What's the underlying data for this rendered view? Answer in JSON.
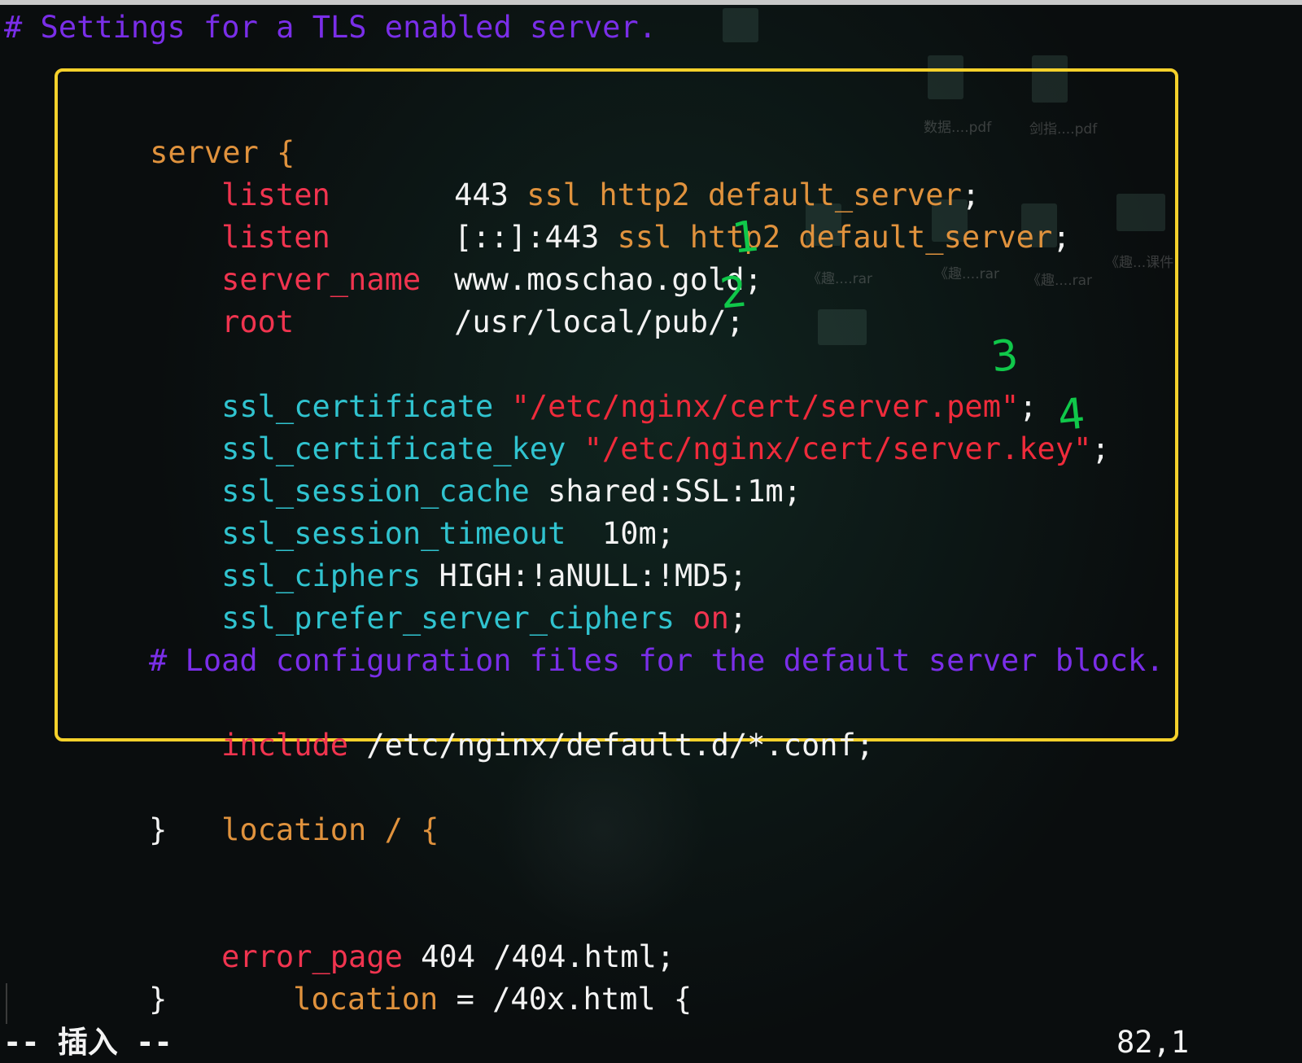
{
  "header_comment": "# Settings for a TLS enabled server.",
  "server_block": {
    "open": "server {",
    "listen1": {
      "directive": "listen",
      "port": "443",
      "args": "ssl http2 default_server",
      "end": ";"
    },
    "listen2": {
      "directive": "listen",
      "port": "[::]:443",
      "args": "ssl http2 default_server",
      "end": ";"
    },
    "server_name": {
      "directive": "server_name",
      "value": "www.moschao.gold;"
    },
    "root": {
      "directive": "root",
      "value": "/usr/local/pub/;"
    },
    "ssl_certificate": {
      "directive": "ssl_certificate",
      "value": "\"/etc/nginx/cert/server.pem\"",
      "end": ";"
    },
    "ssl_certificate_key": {
      "directive": "ssl_certificate_key",
      "value": "\"/etc/nginx/cert/server.key\"",
      "end": ";"
    },
    "ssl_session_cache": {
      "directive": "ssl_session_cache",
      "value": "shared:SSL:1m;"
    },
    "ssl_session_timeout": {
      "directive": "ssl_session_timeout",
      "value": "10m;"
    },
    "ssl_ciphers": {
      "directive": "ssl_ciphers",
      "value": "HIGH:!aNULL:!MD5;"
    },
    "ssl_prefer_server_ciphers": {
      "directive": "ssl_prefer_server_ciphers",
      "value": "on",
      "end": ";"
    },
    "load_comment": "# Load configuration files for the default server block.",
    "include": {
      "directive": "include",
      "value": "/etc/nginx/default.d/*.conf;"
    }
  },
  "after_block": {
    "location_open": "location / {",
    "location_close": "}",
    "error_page": {
      "directive": "error_page",
      "value": "404 /404.html;"
    },
    "location2": {
      "keyword": "location",
      "value": "= /40x.html {"
    },
    "location2_close": "}"
  },
  "annotations": [
    "1",
    "2",
    "3",
    "4"
  ],
  "status": {
    "mode": "-- 插入 --",
    "position": "82,1"
  },
  "desktop_labels": [
    "数据....pdf",
    "剑指....pdf",
    "《趣....rar",
    "《趣....rar",
    "《趣....rar",
    "《趣...课件"
  ],
  "colors": {
    "comment": "#7a2ee8",
    "block": "#e0923d",
    "directive": "#f0344f",
    "ssl_directive": "#30c3cf",
    "string": "#ef2b3b",
    "highlight_border": "#f6d12b",
    "annotation": "#10c84a"
  }
}
